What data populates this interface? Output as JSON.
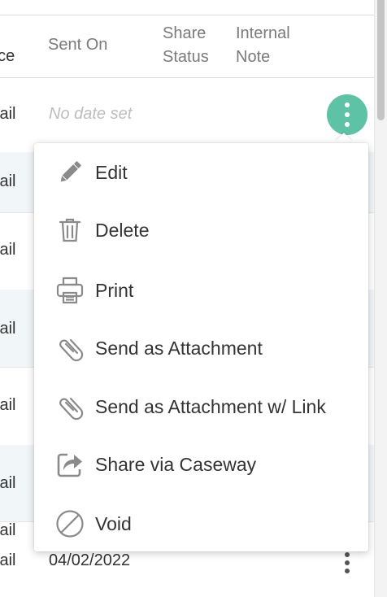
{
  "table": {
    "columns": [
      {
        "label": "y\nnce"
      },
      {
        "label": "Sent On"
      },
      {
        "label": "Share\nStatus"
      },
      {
        "label": "Internal\nNote"
      }
    ],
    "rows": [
      {
        "method": "lail",
        "sent_on": "No date set"
      },
      {
        "method": "lail",
        "sent_on": ""
      },
      {
        "method": "lail",
        "sent_on": ""
      },
      {
        "method": "lail",
        "sent_on": ""
      },
      {
        "method": "lail",
        "sent_on": ""
      },
      {
        "method": "lail",
        "sent_on": ""
      },
      {
        "method": "lail",
        "sent_on": ""
      },
      {
        "method": "lail",
        "sent_on": "04/02/2022"
      }
    ]
  },
  "menu": {
    "items": [
      {
        "label": "Edit",
        "icon": "pencil-icon"
      },
      {
        "label": "Delete",
        "icon": "trash-icon"
      },
      {
        "label": "Print",
        "icon": "printer-icon"
      },
      {
        "label": "Send as Attachment",
        "icon": "paperclip-icon"
      },
      {
        "label": "Send as Attachment w/ Link",
        "icon": "paperclip-icon"
      },
      {
        "label": "Share via Caseway",
        "icon": "share-icon"
      },
      {
        "label": "Void",
        "icon": "void-icon"
      }
    ]
  },
  "colors": {
    "accent": "#5ec2a6",
    "icon": "#8a8a8a",
    "row_shade": "#f1f6f9"
  }
}
